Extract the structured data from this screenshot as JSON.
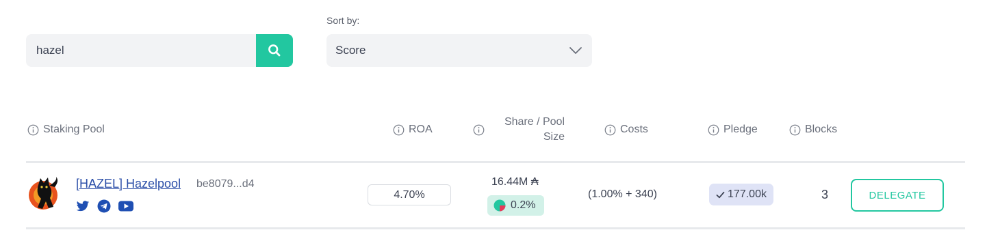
{
  "search": {
    "value": "hazel",
    "placeholder": "",
    "icon": "search-icon"
  },
  "sort": {
    "label": "Sort by:",
    "selected": "Score",
    "icon": "chevron-down-icon"
  },
  "table": {
    "headers": {
      "staking_pool": "Staking Pool",
      "roa": "ROA",
      "share_line1": "Share / Pool",
      "share_line2": "Size",
      "costs": "Costs",
      "pledge": "Pledge",
      "blocks": "Blocks"
    },
    "rows": [
      {
        "name": "[HAZEL] Hazelpool",
        "pool_id": "be8079...d4",
        "roa": "4.70%",
        "pool_size": "16.44M ₳",
        "share": "0.2%",
        "costs": "(1.00% + 340)",
        "pledge": "177.00k",
        "blocks": "3",
        "action": "DELEGATE",
        "socials": [
          "twitter-icon",
          "telegram-icon",
          "youtube-icon"
        ]
      }
    ]
  },
  "colors": {
    "accent": "#22c7a0",
    "link": "#2c4fa8",
    "social": "#1f4fb3",
    "share_badge_bg": "#d2f1e8",
    "pledge_badge_bg": "#dfe3f6"
  }
}
